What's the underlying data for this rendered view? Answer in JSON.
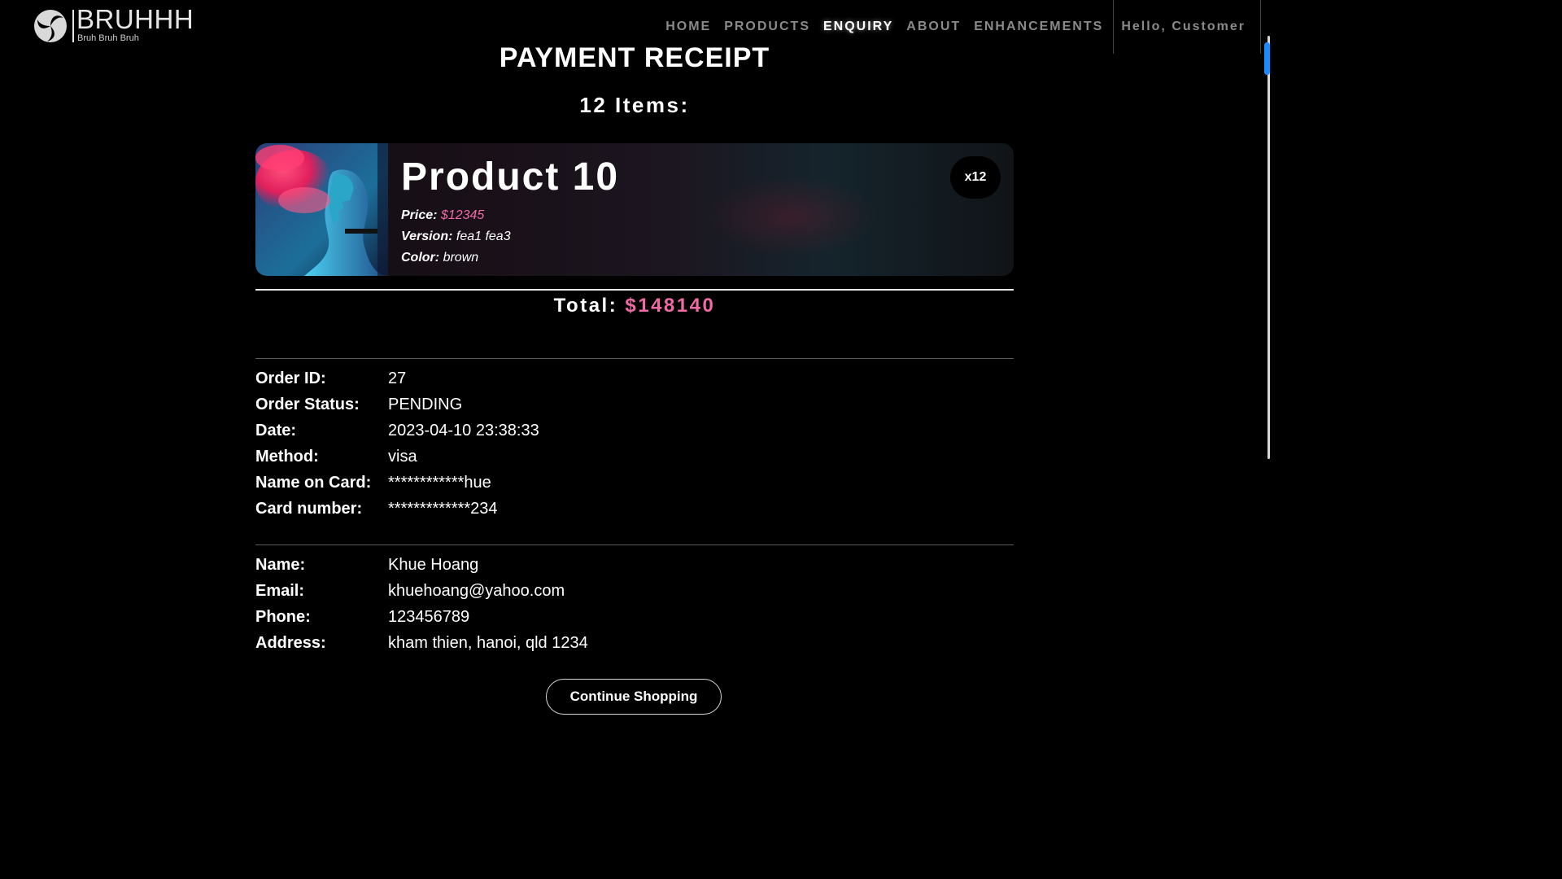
{
  "brand": {
    "name": "BRUHHH",
    "tagline": "Bruh Bruh Bruh"
  },
  "nav": {
    "links": [
      "HOME",
      "PRODUCTS",
      "ENQUIRY",
      "ABOUT",
      "ENHANCEMENTS"
    ],
    "active": "ENQUIRY",
    "greeting": "Hello, Customer"
  },
  "receipt": {
    "title": "PAYMENT RECEIPT",
    "items_heading": "12 Items:",
    "item": {
      "name": "Product 10",
      "price_label": "Price:",
      "price": "$12345",
      "version_label": "Version:",
      "version": "fea1 fea3",
      "color_label": "Color:",
      "color": "brown",
      "quantity": "x12"
    },
    "total_label": "Total:",
    "total": "$148140",
    "order": [
      {
        "label": "Order ID:",
        "value": "27"
      },
      {
        "label": "Order Status:",
        "value": "PENDING"
      },
      {
        "label": "Date:",
        "value": "2023-04-10 23:38:33"
      },
      {
        "label": "Method:",
        "value": "visa"
      },
      {
        "label": "Name on Card:",
        "value": "************hue"
      },
      {
        "label": "Card number:",
        "value": "*************234"
      }
    ],
    "customer": [
      {
        "label": "Name:",
        "value": "Khue Hoang"
      },
      {
        "label": "Email:",
        "value": "khuehoang@yahoo.com"
      },
      {
        "label": "Phone:",
        "value": "123456789"
      },
      {
        "label": "Address:",
        "value": "kham thien, hanoi, qld 1234"
      }
    ],
    "continue_label": "Continue Shopping"
  },
  "colors": {
    "accent_pink": "#f06aa5",
    "background": "#000000",
    "nav_inactive": "#8a8a8a",
    "scroll_thumb": "#1a8cff"
  }
}
